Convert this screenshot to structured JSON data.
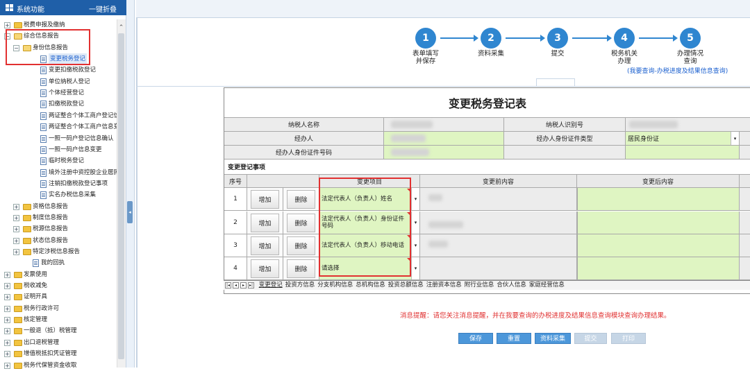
{
  "sidebar": {
    "title": "系统功能",
    "collapse_all": "一键折叠",
    "items": [
      {
        "label": "税费申报及缴纳",
        "level": 0,
        "kind": "folder",
        "toggle": "+"
      },
      {
        "label": "综合信息报告",
        "level": 0,
        "kind": "folder-open",
        "toggle": "−"
      },
      {
        "label": "身份信息报告",
        "level": 1,
        "kind": "folder-open",
        "toggle": "−"
      },
      {
        "label": "变更税务登记",
        "level": 2,
        "kind": "page",
        "selected": true
      },
      {
        "label": "变更扣缴税款登记",
        "level": 2,
        "kind": "page"
      },
      {
        "label": "单位纳税人登记",
        "level": 2,
        "kind": "page"
      },
      {
        "label": "个体经营登记",
        "level": 2,
        "kind": "page"
      },
      {
        "label": "扣缴税款登记",
        "level": 2,
        "kind": "page"
      },
      {
        "label": "两证整合个体工商户登记信",
        "level": 2,
        "kind": "page"
      },
      {
        "label": "两证整合个体工商户信息变",
        "level": 2,
        "kind": "page"
      },
      {
        "label": "一照一码户登记信息确认",
        "level": 2,
        "kind": "page"
      },
      {
        "label": "一照一码户信息变更",
        "level": 2,
        "kind": "page"
      },
      {
        "label": "临时税务登记",
        "level": 2,
        "kind": "page"
      },
      {
        "label": "境外注册中资控股企业居民",
        "level": 2,
        "kind": "page"
      },
      {
        "label": "注销扣缴税款登记事项",
        "level": 2,
        "kind": "page"
      },
      {
        "label": "实名办税信息采集",
        "level": 2,
        "kind": "page"
      },
      {
        "label": "资格信息报告",
        "level": 1,
        "kind": "folder",
        "toggle": "+"
      },
      {
        "label": "制度信息报告",
        "level": 1,
        "kind": "folder",
        "toggle": "+"
      },
      {
        "label": "税源信息报告",
        "level": 1,
        "kind": "folder",
        "toggle": "+"
      },
      {
        "label": "状态信息报告",
        "level": 1,
        "kind": "folder",
        "toggle": "+"
      },
      {
        "label": "特定涉税信息报告",
        "level": 1,
        "kind": "folder",
        "toggle": "+"
      },
      {
        "label": "我的回执",
        "level": 1,
        "kind": "page"
      },
      {
        "label": "发票使用",
        "level": 0,
        "kind": "folder",
        "toggle": "+"
      },
      {
        "label": "税收减免",
        "level": 0,
        "kind": "folder",
        "toggle": "+"
      },
      {
        "label": "证明开具",
        "level": 0,
        "kind": "folder",
        "toggle": "+"
      },
      {
        "label": "税务行政许可",
        "level": 0,
        "kind": "folder",
        "toggle": "+"
      },
      {
        "label": "核定管理",
        "level": 0,
        "kind": "folder",
        "toggle": "+"
      },
      {
        "label": "一般退（抵）税管理",
        "level": 0,
        "kind": "folder",
        "toggle": "+"
      },
      {
        "label": "出口退税管理",
        "level": 0,
        "kind": "folder",
        "toggle": "+"
      },
      {
        "label": "增值税抵扣凭证管理",
        "level": 0,
        "kind": "folder",
        "toggle": "+"
      },
      {
        "label": "税务代保管资金收取",
        "level": 0,
        "kind": "folder",
        "toggle": "+"
      }
    ]
  },
  "steps": [
    {
      "num": "1",
      "label": "表单填写\n并保存"
    },
    {
      "num": "2",
      "label": "资料采集"
    },
    {
      "num": "3",
      "label": "提交"
    },
    {
      "num": "4",
      "label": "税务机关\n办理"
    },
    {
      "num": "5",
      "label": "办理情况\n查询"
    }
  ],
  "query_link": "(我要查询-办税进度及结果信息查询)",
  "form": {
    "title": "变更税务登记表",
    "taxpayer_name_label": "纳税人名称",
    "taxpayer_id_label": "纳税人识别号",
    "agent_label": "经办人",
    "agent_id_type_label": "经办人身份证件类型",
    "agent_id_type_value": "居民身份证",
    "agent_id_no_label": "经办人身份证件号码",
    "section_label": "变更登记事项",
    "col_seq": "序号",
    "col_item": "变更项目",
    "col_before": "变更前内容",
    "col_after": "变更后内容",
    "add_label": "增加",
    "del_label": "删除",
    "rows": [
      {
        "seq": "1",
        "item": "法定代表人（负责人）姓名"
      },
      {
        "seq": "2",
        "item": "法定代表人（负责人）身份证件号码"
      },
      {
        "seq": "3",
        "item": "法定代表人（负责人）移动电话"
      },
      {
        "seq": "4",
        "item": "请选择"
      }
    ]
  },
  "sheet_tabs": [
    "变更登记",
    "投资方信息",
    "分支机构信息",
    "总机构信息",
    "投资总额信息",
    "注册资本信息",
    "附行业信息",
    "合伙人信息",
    "家庭经营信息"
  ],
  "notice": "消息提醒：请您关注消息提醒，并在我要查询的办税进度及结果信息查询模块查询办理结果。",
  "actions": {
    "save": "保存",
    "reset": "重置",
    "collect": "资料采集",
    "submit": "提交",
    "print": "打印"
  }
}
